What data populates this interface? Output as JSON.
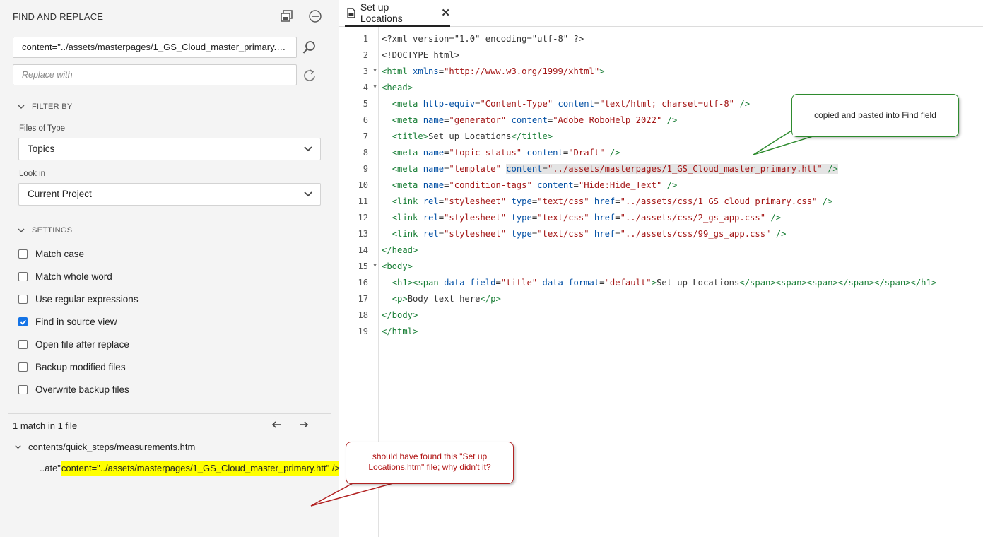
{
  "find_replace": {
    "title": "FIND AND REPLACE",
    "find_value": "content=\"../assets/masterpages/1_GS_Cloud_master_primary.htt...",
    "replace_placeholder": "Replace with",
    "filter_heading": "FILTER BY",
    "files_of_type_label": "Files of Type",
    "files_of_type_value": "Topics",
    "look_in_label": "Look in",
    "look_in_value": "Current Project",
    "settings_heading": "SETTINGS",
    "options": [
      {
        "label": "Match case",
        "checked": false
      },
      {
        "label": "Match whole word",
        "checked": false
      },
      {
        "label": "Use regular expressions",
        "checked": false
      },
      {
        "label": "Find in source view",
        "checked": true
      },
      {
        "label": "Open file after replace",
        "checked": false
      },
      {
        "label": "Backup modified files",
        "checked": false
      },
      {
        "label": "Overwrite backup files",
        "checked": false
      }
    ],
    "results": {
      "summary": "1 match in 1 file",
      "file_path": "contents/quick_steps/measurements.htm",
      "match_prefix": "..ate\"",
      "match_text": "content=\"../assets/masterpages/1_GS_Cloud_master_primary.htt\" />"
    }
  },
  "editor": {
    "tab_title": "Set up Locations",
    "tab_close": "✕",
    "line_numbers": [
      "1",
      "2",
      "3",
      "4",
      "5",
      "6",
      "7",
      "8",
      "9",
      "10",
      "11",
      "12",
      "13",
      "14",
      "15",
      "16",
      "17",
      "18",
      "19"
    ],
    "lines": [
      {
        "ind": "",
        "parts": [
          [
            "m",
            "<?xml version=\"1.0\" encoding=\"utf-8\" ?>"
          ]
        ]
      },
      {
        "ind": "",
        "parts": [
          [
            "m",
            "<!DOCTYPE html>"
          ]
        ]
      },
      {
        "ind": "",
        "parts": [
          [
            "g",
            "<html "
          ],
          [
            "a",
            "xmlns"
          ],
          [
            "m",
            "="
          ],
          [
            "v",
            "\"http://www.w3.org/1999/xhtml\""
          ],
          [
            "g",
            ">"
          ]
        ]
      },
      {
        "ind": "",
        "parts": [
          [
            "g",
            "<head>"
          ]
        ]
      },
      {
        "ind": "  ",
        "parts": [
          [
            "g",
            "<meta "
          ],
          [
            "a",
            "http-equiv"
          ],
          [
            "m",
            "="
          ],
          [
            "v",
            "\"Content-Type\""
          ],
          [
            "m",
            " "
          ],
          [
            "a",
            "content"
          ],
          [
            "m",
            "="
          ],
          [
            "v",
            "\"text/html; charset=utf-8\""
          ],
          [
            "g",
            " />"
          ]
        ]
      },
      {
        "ind": "  ",
        "parts": [
          [
            "g",
            "<meta "
          ],
          [
            "a",
            "name"
          ],
          [
            "m",
            "="
          ],
          [
            "v",
            "\"generator\""
          ],
          [
            "m",
            " "
          ],
          [
            "a",
            "content"
          ],
          [
            "m",
            "="
          ],
          [
            "v",
            "\"Adobe RoboHelp 2022\""
          ],
          [
            "g",
            " />"
          ]
        ]
      },
      {
        "ind": "  ",
        "parts": [
          [
            "g",
            "<title>"
          ],
          [
            "m",
            "Set up Locations"
          ],
          [
            "g",
            "</title>"
          ]
        ]
      },
      {
        "ind": "  ",
        "parts": [
          [
            "g",
            "<meta "
          ],
          [
            "a",
            "name"
          ],
          [
            "m",
            "="
          ],
          [
            "v",
            "\"topic-status\""
          ],
          [
            "m",
            " "
          ],
          [
            "a",
            "content"
          ],
          [
            "m",
            "="
          ],
          [
            "v",
            "\"Draft\""
          ],
          [
            "g",
            " />"
          ]
        ]
      },
      {
        "ind": "  ",
        "parts": [
          [
            "g",
            "<meta "
          ],
          [
            "a",
            "name"
          ],
          [
            "m",
            "="
          ],
          [
            "v",
            "\"template\""
          ],
          [
            "m",
            " "
          ],
          [
            "a sel",
            "content"
          ],
          [
            "m sel",
            "="
          ],
          [
            "v sel",
            "\"../assets/masterpages/1_GS_Cloud_master_primary.htt\""
          ],
          [
            "g sel",
            " />"
          ]
        ]
      },
      {
        "ind": "  ",
        "parts": [
          [
            "g",
            "<meta "
          ],
          [
            "a",
            "name"
          ],
          [
            "m",
            "="
          ],
          [
            "v",
            "\"condition-tags\""
          ],
          [
            "m",
            " "
          ],
          [
            "a",
            "content"
          ],
          [
            "m",
            "="
          ],
          [
            "v",
            "\"Hide:Hide_Text\""
          ],
          [
            "g",
            " />"
          ]
        ]
      },
      {
        "ind": "  ",
        "parts": [
          [
            "g",
            "<link "
          ],
          [
            "a",
            "rel"
          ],
          [
            "m",
            "="
          ],
          [
            "v",
            "\"stylesheet\""
          ],
          [
            "m",
            " "
          ],
          [
            "a",
            "type"
          ],
          [
            "m",
            "="
          ],
          [
            "v",
            "\"text/css\""
          ],
          [
            "m",
            " "
          ],
          [
            "a",
            "href"
          ],
          [
            "m",
            "="
          ],
          [
            "v",
            "\"../assets/css/1_GS_cloud_primary.css\""
          ],
          [
            "g",
            " />"
          ]
        ]
      },
      {
        "ind": "  ",
        "parts": [
          [
            "g",
            "<link "
          ],
          [
            "a",
            "rel"
          ],
          [
            "m",
            "="
          ],
          [
            "v",
            "\"stylesheet\""
          ],
          [
            "m",
            " "
          ],
          [
            "a",
            "type"
          ],
          [
            "m",
            "="
          ],
          [
            "v",
            "\"text/css\""
          ],
          [
            "m",
            " "
          ],
          [
            "a",
            "href"
          ],
          [
            "m",
            "="
          ],
          [
            "v",
            "\"../assets/css/2_gs_app.css\""
          ],
          [
            "g",
            " />"
          ]
        ]
      },
      {
        "ind": "  ",
        "parts": [
          [
            "g",
            "<link "
          ],
          [
            "a",
            "rel"
          ],
          [
            "m",
            "="
          ],
          [
            "v",
            "\"stylesheet\""
          ],
          [
            "m",
            " "
          ],
          [
            "a",
            "type"
          ],
          [
            "m",
            "="
          ],
          [
            "v",
            "\"text/css\""
          ],
          [
            "m",
            " "
          ],
          [
            "a",
            "href"
          ],
          [
            "m",
            "="
          ],
          [
            "v",
            "\"../assets/css/99_gs_app.css\""
          ],
          [
            "g",
            " />"
          ]
        ]
      },
      {
        "ind": "",
        "parts": [
          [
            "g",
            "</head>"
          ]
        ]
      },
      {
        "ind": "",
        "parts": [
          [
            "g",
            "<body>"
          ]
        ]
      },
      {
        "ind": "  ",
        "parts": [
          [
            "g",
            "<h1><span "
          ],
          [
            "a",
            "data-field"
          ],
          [
            "m",
            "="
          ],
          [
            "v",
            "\"title\""
          ],
          [
            "m",
            " "
          ],
          [
            "a",
            "data-format"
          ],
          [
            "m",
            "="
          ],
          [
            "v",
            "\"default\""
          ],
          [
            "g",
            ">"
          ],
          [
            "m",
            "Set up Locations"
          ],
          [
            "g",
            "</span><span><span></span></span></h1>"
          ]
        ]
      },
      {
        "ind": "  ",
        "parts": [
          [
            "g",
            "<p>"
          ],
          [
            "m",
            "Body text here"
          ],
          [
            "g",
            "</p>"
          ]
        ]
      },
      {
        "ind": "",
        "parts": [
          [
            "g",
            "</body>"
          ]
        ]
      },
      {
        "ind": "",
        "parts": [
          [
            "g",
            "</html>"
          ]
        ]
      }
    ],
    "foldable_lines": [
      3,
      4,
      15
    ]
  },
  "annotations": {
    "top_callout": "copied and pasted into Find field",
    "bottom_callout": "should have found this \"Set up Locations.htm\" file; why didn't it?",
    "top_color": "#2e8b2e",
    "bottom_color": "#b22222"
  }
}
